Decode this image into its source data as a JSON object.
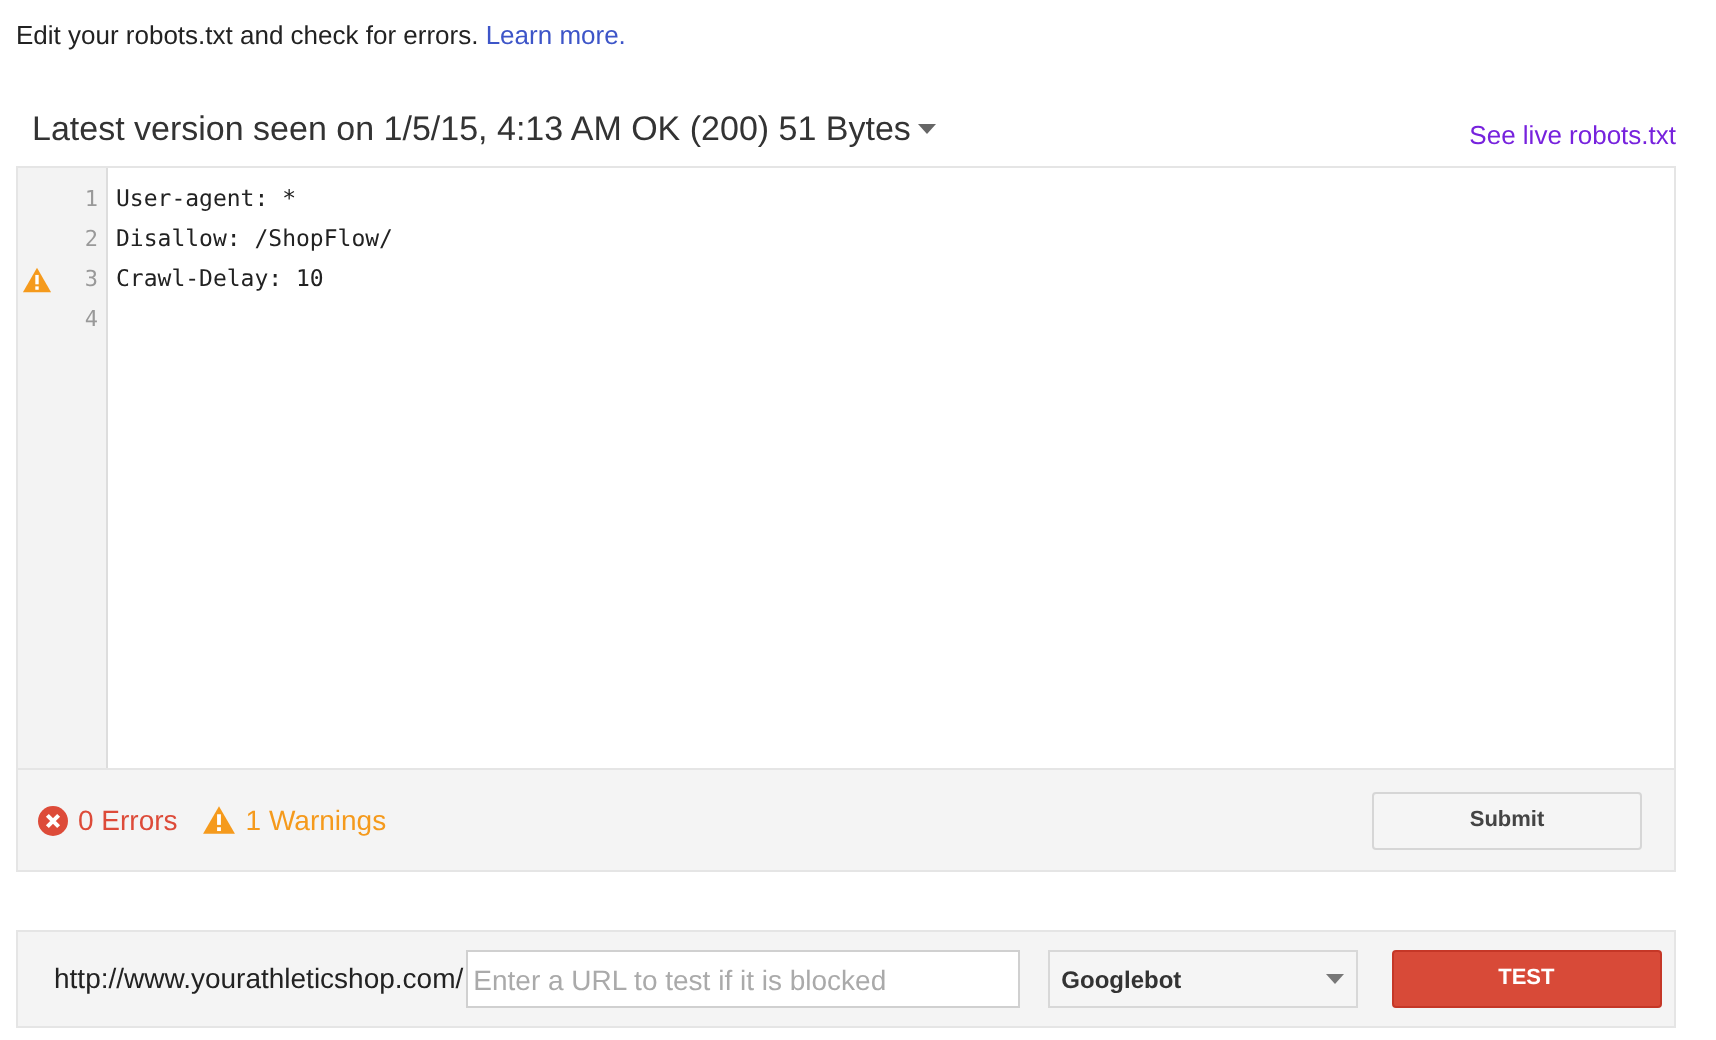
{
  "intro": {
    "text": "Edit your robots.txt and check for errors.",
    "link": "Learn more."
  },
  "version": {
    "heading": "Latest version seen on 1/5/15, 4:13 AM OK (200) 51 Bytes",
    "live_link": "See live robots.txt"
  },
  "editor": {
    "lines": [
      {
        "number": "1",
        "text": "User-agent: *",
        "warning": false
      },
      {
        "number": "2",
        "text": "Disallow: /ShopFlow/",
        "warning": false
      },
      {
        "number": "3",
        "text": "Crawl-Delay: 10",
        "warning": true
      },
      {
        "number": "4",
        "warning": false
      }
    ]
  },
  "status": {
    "errors": "0 Errors",
    "warnings": "1 Warnings",
    "submit": "Submit"
  },
  "test_bar": {
    "url_prefix": "http://www.yourathleticshop.com/",
    "url_field": {
      "placeholder": "Enter a URL to test if it is blocked"
    },
    "agent": "Googlebot",
    "button": "TEST"
  }
}
